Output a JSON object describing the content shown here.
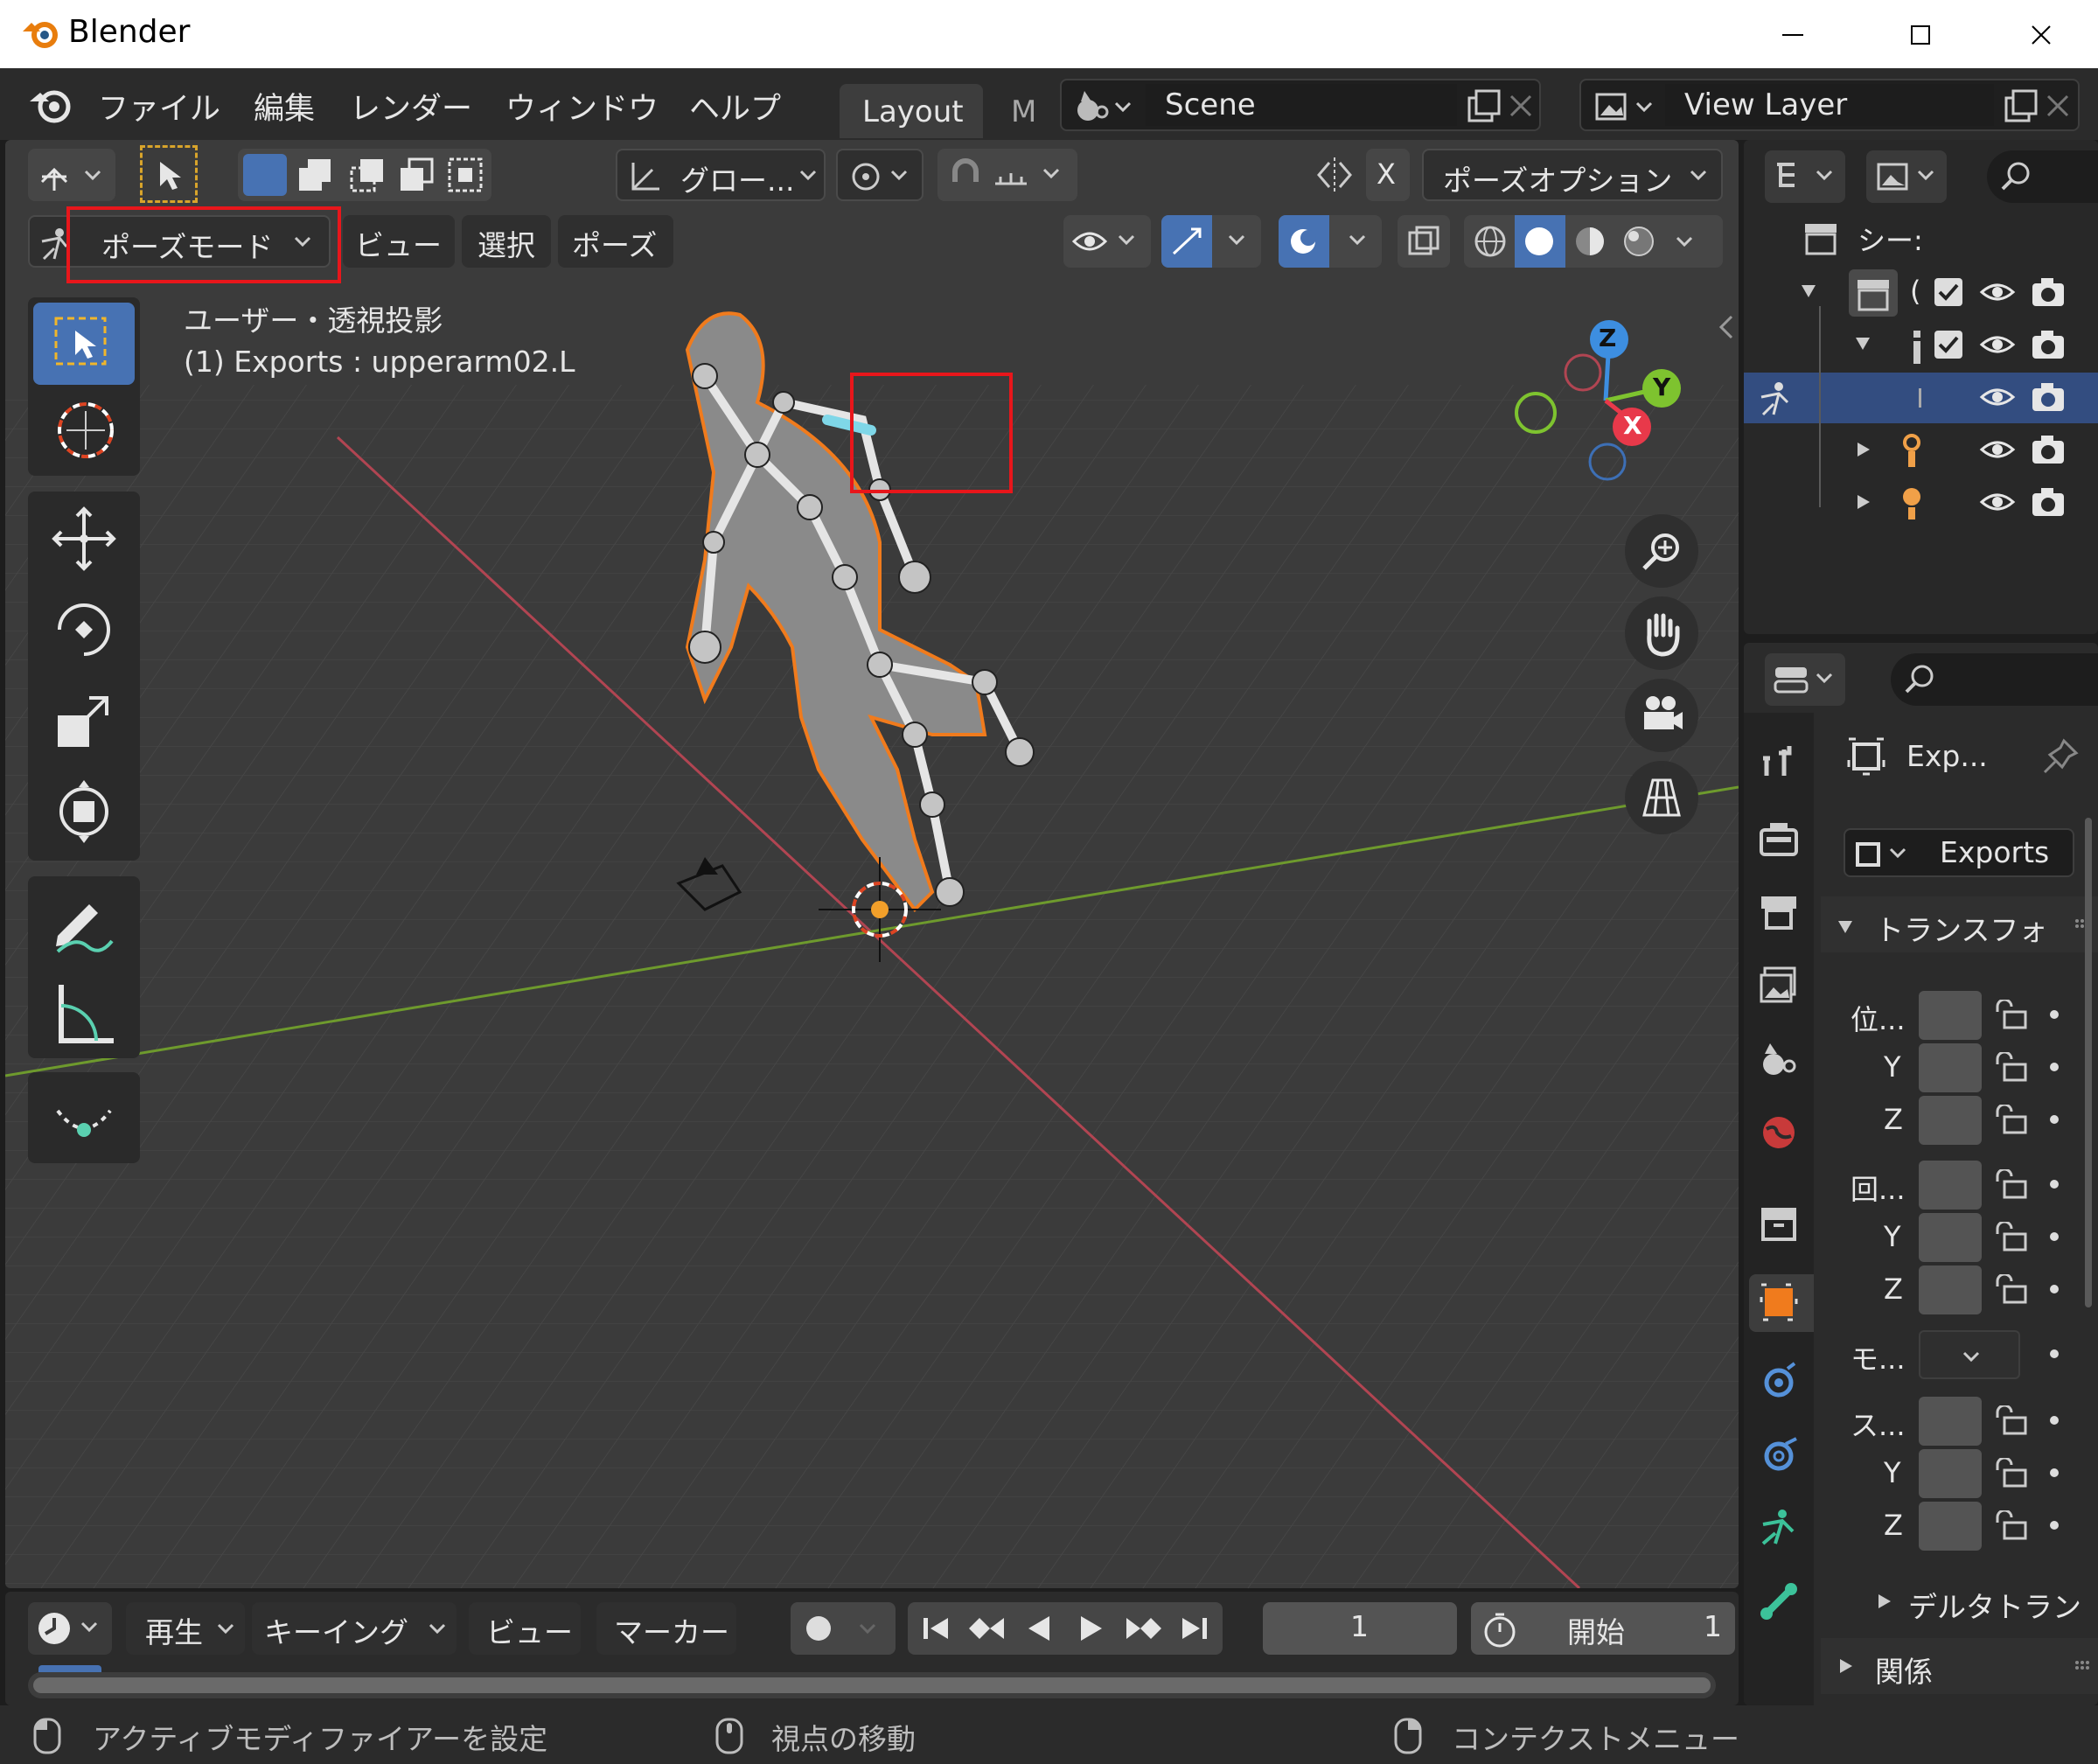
{
  "window": {
    "title": "Blender",
    "controls": [
      "minimize",
      "maximize",
      "close"
    ]
  },
  "menubar": {
    "items": [
      "ファイル",
      "編集",
      "レンダー",
      "ウィンドウ",
      "ヘルプ"
    ],
    "workspace_tabs": [
      "Layout",
      "M"
    ],
    "active_tab": "Layout",
    "scene": "Scene",
    "view_layer": "View Layer"
  },
  "viewport_header": {
    "transform_orientation": "グロー...",
    "axis_label": "X",
    "pose_options": "ポーズオプション",
    "mode": "ポーズモード",
    "menus": [
      "ビュー",
      "選択",
      "ポーズ"
    ]
  },
  "viewport": {
    "view_name": "ユーザー・透視投影",
    "active_info": "(1) Exports : upperarm02.L",
    "gizmo_axes": {
      "z": "Z",
      "y": "Y",
      "x": "X"
    }
  },
  "outliner": {
    "root_label": "シー:",
    "rows": [
      {
        "label": "(",
        "checked": true
      },
      {
        "label": "",
        "checked": true
      },
      {
        "label": "",
        "selected": true
      },
      {
        "label": ""
      },
      {
        "label": ""
      }
    ]
  },
  "properties": {
    "header_object": "Exp...",
    "object_name": "Exports",
    "section_transform": "トランスフォ",
    "fields": [
      {
        "label": "位...",
        "group": "location"
      },
      {
        "label": "Y",
        "group": "location"
      },
      {
        "label": "Z",
        "group": "location"
      },
      {
        "label": "回...",
        "group": "rotation"
      },
      {
        "label": "Y",
        "group": "rotation"
      },
      {
        "label": "Z",
        "group": "rotation"
      },
      {
        "label": "モ...",
        "group": "mode"
      },
      {
        "label": "ス...",
        "group": "scale"
      },
      {
        "label": "Y",
        "group": "scale"
      },
      {
        "label": "Z",
        "group": "scale"
      }
    ],
    "section_delta": "デルタトラン",
    "section_relations": "関係"
  },
  "timeline": {
    "playback": "再生",
    "keying": "キーイング",
    "view": "ビュー",
    "marker": "マーカー",
    "current_frame": "1",
    "start_label": "開始",
    "start_value": "1"
  },
  "statusbar": {
    "left": "アクティブモディファイアーを設定",
    "middle": "視点の移動",
    "right": "コンテクストメニュー"
  },
  "colors": {
    "highlight_box": "#e8161b",
    "axis_x": "#e8394a",
    "axis_y": "#7ec32f",
    "axis_z": "#3d8ee0",
    "selected_bone": "#7fd7e8",
    "outline": "#f07b1d",
    "active_blue": "#3e6fb5"
  }
}
